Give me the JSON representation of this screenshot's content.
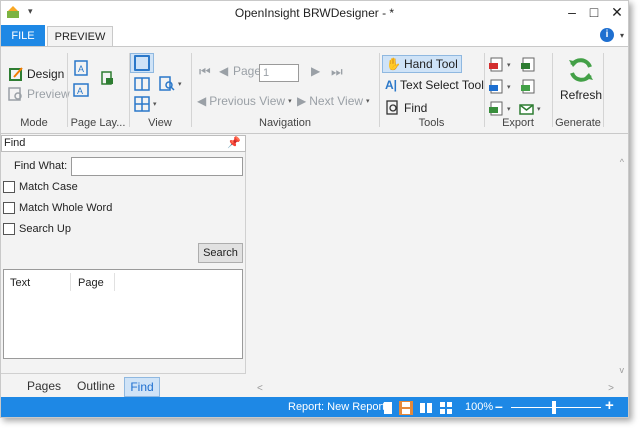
{
  "window": {
    "title": "OpenInsight BRWDesigner - *",
    "minimize": "–",
    "maximize": "□",
    "close": "✕",
    "qat_arrow": "▾"
  },
  "tabs": {
    "file": "FILE",
    "preview": "PREVIEW",
    "help": "i"
  },
  "ribbon": {
    "mode": {
      "label": "Mode",
      "design": "Design",
      "preview": "Preview"
    },
    "page_layout": {
      "label": "Page Lay..."
    },
    "view": {
      "label": "View"
    },
    "navigation": {
      "label": "Navigation",
      "page_label": "Page",
      "page_value": "1",
      "previous_view": "Previous View",
      "next_view": "Next View"
    },
    "tools": {
      "label": "Tools",
      "hand_tool": "Hand Tool",
      "text_select_tool": "Text Select Tool",
      "find": "Find"
    },
    "export": {
      "label": "Export"
    },
    "generate": {
      "label": "Generate",
      "refresh": "Refresh"
    }
  },
  "find_pane": {
    "header": "Find",
    "find_what_label": "Find What:",
    "find_what_value": "",
    "match_case": "Match Case",
    "match_whole_word": "Match Whole Word",
    "search_up": "Search Up",
    "search_button": "Search",
    "columns": [
      "Text",
      "Page"
    ],
    "tabs": [
      "Pages",
      "Outline",
      "Find"
    ]
  },
  "statusbar": {
    "report": "Report: New Report",
    "zoom": "100%",
    "zoom_minus": "–",
    "zoom_plus": "+"
  },
  "colors": {
    "accent": "#1e88e5",
    "ribbon_bg": "#f3f3f3",
    "active_bg": "#cfe3f7"
  }
}
